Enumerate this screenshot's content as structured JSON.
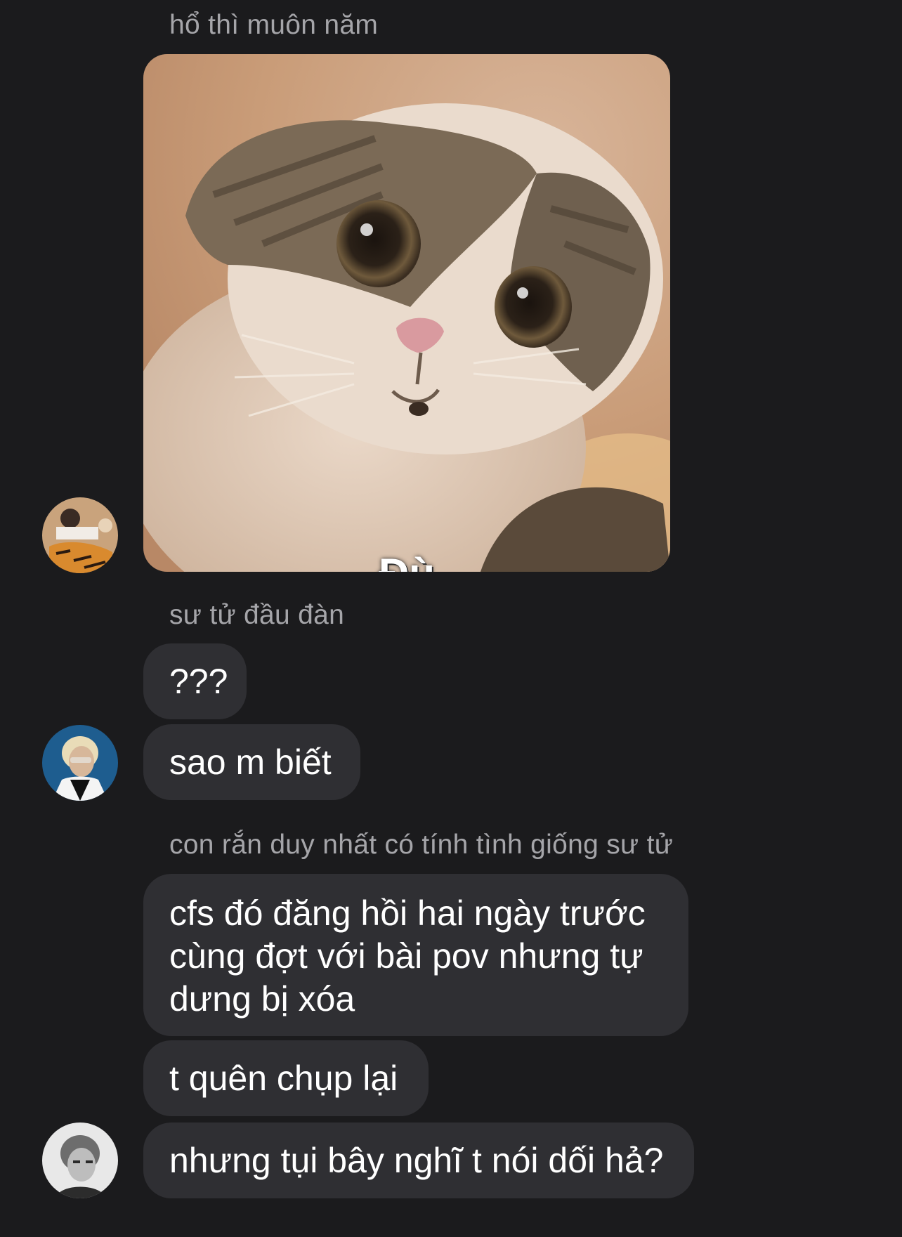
{
  "messages": [
    {
      "sender": "hổ thì muôn năm",
      "photo": {
        "caption": "Đù",
        "subject": "surprised-cat-meme"
      }
    },
    {
      "sender": "sư tử đầu đàn",
      "bubbles": [
        "???",
        "sao m biết"
      ]
    },
    {
      "sender": "con rắn duy nhất có tính tình giống sư tử",
      "bubbles": [
        [
          "cfs đó đăng hồi hai ngày trước",
          "cùng đợt với bài pov nhưng tự",
          "dưng bị xóa"
        ],
        "t quên chụp lại",
        "nhưng tụi bây nghĩ t nói dối hả?"
      ]
    }
  ],
  "colors": {
    "background": "#1b1b1d",
    "bubble": "#2f2f33",
    "sender_name": "#a5a5a9",
    "text": "#ffffff"
  }
}
